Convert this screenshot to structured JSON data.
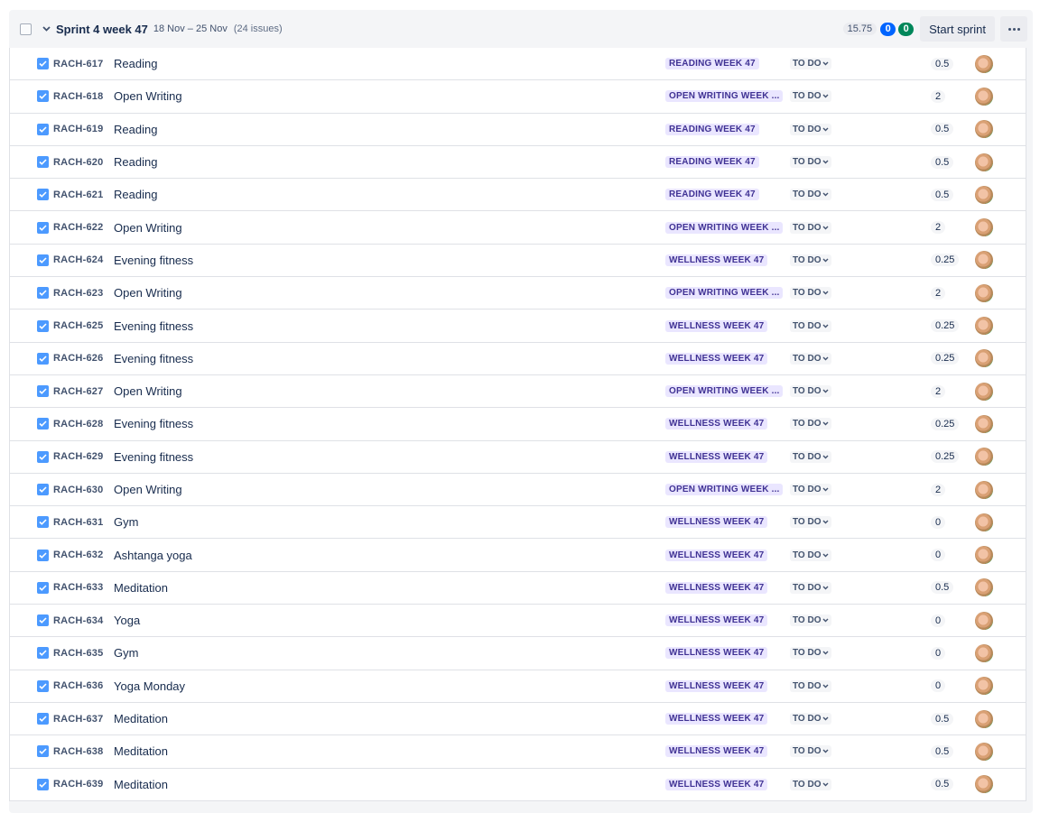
{
  "sprint": {
    "name": "Sprint 4 week 47",
    "dates": "18 Nov – 25 Nov",
    "issue_count": "(24 issues)",
    "points_total": "15.75",
    "in_progress_count": "0",
    "done_count": "0",
    "start_button": "Start sprint",
    "colors": {
      "in_progress": "#0065ff",
      "done": "#00875a",
      "epic_bg": "#eae6ff",
      "epic_text": "#403294",
      "checkbox": "#4c9aff"
    }
  },
  "issues": [
    {
      "key": "RACH-617",
      "summary": "Reading",
      "epic": "READING WEEK 47",
      "status": "TO DO",
      "estimate": "0.5"
    },
    {
      "key": "RACH-618",
      "summary": "Open Writing",
      "epic": "OPEN WRITING WEEK ...",
      "status": "TO DO",
      "estimate": "2"
    },
    {
      "key": "RACH-619",
      "summary": "Reading",
      "epic": "READING WEEK 47",
      "status": "TO DO",
      "estimate": "0.5"
    },
    {
      "key": "RACH-620",
      "summary": "Reading",
      "epic": "READING WEEK 47",
      "status": "TO DO",
      "estimate": "0.5"
    },
    {
      "key": "RACH-621",
      "summary": "Reading",
      "epic": "READING WEEK 47",
      "status": "TO DO",
      "estimate": "0.5"
    },
    {
      "key": "RACH-622",
      "summary": "Open Writing",
      "epic": "OPEN WRITING WEEK ...",
      "status": "TO DO",
      "estimate": "2"
    },
    {
      "key": "RACH-624",
      "summary": "Evening fitness",
      "epic": "WELLNESS WEEK 47",
      "status": "TO DO",
      "estimate": "0.25"
    },
    {
      "key": "RACH-623",
      "summary": "Open Writing",
      "epic": "OPEN WRITING WEEK ...",
      "status": "TO DO",
      "estimate": "2"
    },
    {
      "key": "RACH-625",
      "summary": "Evening fitness",
      "epic": "WELLNESS WEEK 47",
      "status": "TO DO",
      "estimate": "0.25"
    },
    {
      "key": "RACH-626",
      "summary": "Evening fitness",
      "epic": "WELLNESS WEEK 47",
      "status": "TO DO",
      "estimate": "0.25"
    },
    {
      "key": "RACH-627",
      "summary": "Open Writing",
      "epic": "OPEN WRITING WEEK ...",
      "status": "TO DO",
      "estimate": "2"
    },
    {
      "key": "RACH-628",
      "summary": "Evening fitness",
      "epic": "WELLNESS WEEK 47",
      "status": "TO DO",
      "estimate": "0.25"
    },
    {
      "key": "RACH-629",
      "summary": "Evening fitness",
      "epic": "WELLNESS WEEK 47",
      "status": "TO DO",
      "estimate": "0.25"
    },
    {
      "key": "RACH-630",
      "summary": "Open Writing",
      "epic": "OPEN WRITING WEEK ...",
      "status": "TO DO",
      "estimate": "2"
    },
    {
      "key": "RACH-631",
      "summary": "Gym",
      "epic": "WELLNESS WEEK 47",
      "status": "TO DO",
      "estimate": "0"
    },
    {
      "key": "RACH-632",
      "summary": "Ashtanga yoga",
      "epic": "WELLNESS WEEK 47",
      "status": "TO DO",
      "estimate": "0"
    },
    {
      "key": "RACH-633",
      "summary": "Meditation",
      "epic": "WELLNESS WEEK 47",
      "status": "TO DO",
      "estimate": "0.5"
    },
    {
      "key": "RACH-634",
      "summary": "Yoga",
      "epic": "WELLNESS WEEK 47",
      "status": "TO DO",
      "estimate": "0"
    },
    {
      "key": "RACH-635",
      "summary": "Gym",
      "epic": "WELLNESS WEEK 47",
      "status": "TO DO",
      "estimate": "0"
    },
    {
      "key": "RACH-636",
      "summary": "Yoga Monday",
      "epic": "WELLNESS WEEK 47",
      "status": "TO DO",
      "estimate": "0"
    },
    {
      "key": "RACH-637",
      "summary": "Meditation",
      "epic": "WELLNESS WEEK 47",
      "status": "TO DO",
      "estimate": "0.5"
    },
    {
      "key": "RACH-638",
      "summary": "Meditation",
      "epic": "WELLNESS WEEK 47",
      "status": "TO DO",
      "estimate": "0.5"
    },
    {
      "key": "RACH-639",
      "summary": "Meditation",
      "epic": "WELLNESS WEEK 47",
      "status": "TO DO",
      "estimate": "0.5"
    }
  ]
}
